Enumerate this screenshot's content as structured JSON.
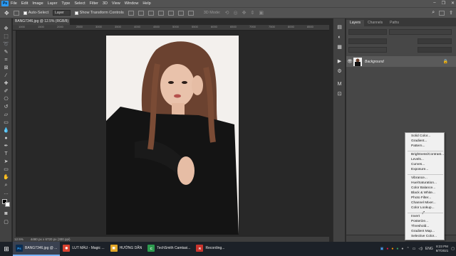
{
  "menu": {
    "logo": "Ps",
    "items": [
      "File",
      "Edit",
      "Image",
      "Layer",
      "Type",
      "Select",
      "Filter",
      "3D",
      "View",
      "Window",
      "Help"
    ]
  },
  "options": {
    "auto_select": "Auto-Select",
    "target": "Layer",
    "show_transform": "Show Transform Controls",
    "mode_3d": "3D Mode:"
  },
  "document": {
    "tab_title": "BANG7346.jpg @ 12.5% (RGB/8) *",
    "ruler_ticks": [
      "1000",
      "1500",
      "2000",
      "2500",
      "3000",
      "3500",
      "4000",
      "4500",
      "5000",
      "5500",
      "6000",
      "6500",
      "7000",
      "7500",
      "8000",
      "8500"
    ],
    "zoom": "12.5%",
    "dimensions": "4480 px x 6720 px (300 ppi)"
  },
  "panel": {
    "tabs": [
      "Layers",
      "Channels",
      "Paths"
    ],
    "layer_name": "Background"
  },
  "adjustment_menu": {
    "groups": [
      [
        "Solid Color...",
        "Gradient...",
        "Pattern..."
      ],
      [
        "Brightness/Contrast...",
        "Levels...",
        "Curves...",
        "Exposure..."
      ],
      [
        "Vibrance...",
        "Hue/Saturation...",
        "Color Balance...",
        "Black & White...",
        "Photo Filter...",
        "Channel Mixer...",
        "Color Lookup..."
      ],
      [
        "Invert",
        "Posterize...",
        "Threshold...",
        "Gradient Map...",
        "Selective Color..."
      ]
    ]
  },
  "taskbar": {
    "apps": [
      {
        "icon": "Ps",
        "label": "BANG7346.jpg @ ...",
        "color": "#0b2d52",
        "active": true
      },
      {
        "icon": "◉",
        "label": "LUT MÀU - Magic ...",
        "color": "#d8412f",
        "active": false
      },
      {
        "icon": "▣",
        "label": "HƯỚNG DẪN",
        "color": "#e0a526",
        "active": false
      },
      {
        "icon": "C",
        "label": "TechSmith Camtasi...",
        "color": "#2d9b4e",
        "active": false
      },
      {
        "icon": "R",
        "label": "Recording...",
        "color": "#c9342d",
        "active": false
      }
    ],
    "lang": "ENG",
    "time": "8:23 PM",
    "date": "8/7/2021"
  }
}
